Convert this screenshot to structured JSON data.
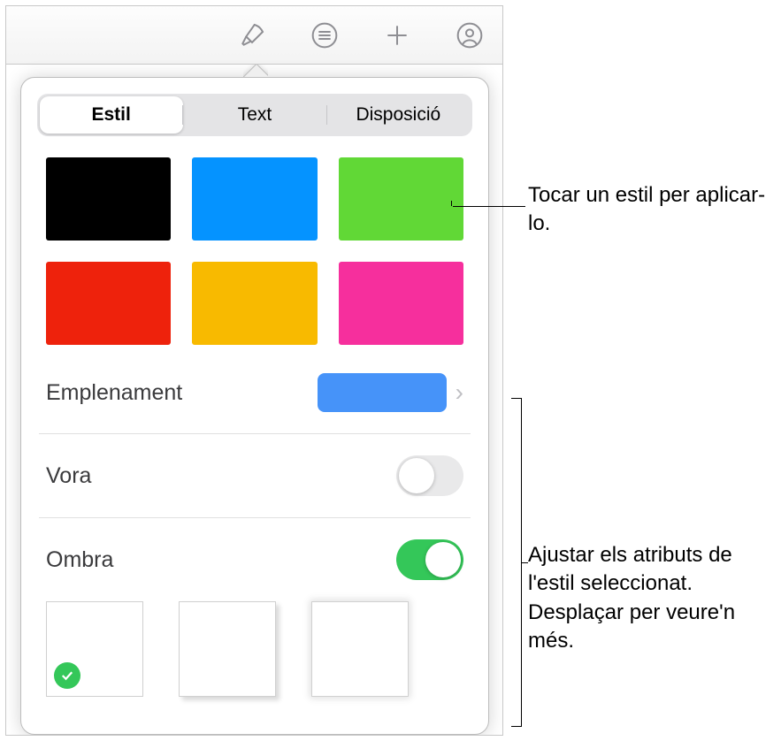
{
  "tabs": {
    "style": "Estil",
    "text": "Text",
    "layout": "Disposició"
  },
  "swatches": {
    "black": "#000000",
    "blue": "#0593ff",
    "green": "#61d836",
    "red": "#ee220c",
    "orange": "#f8ba00",
    "pink": "#f62f9d"
  },
  "rows": {
    "fill": "Emplenament",
    "border": "Vora",
    "shadow": "Ombra"
  },
  "fill_color": "#4693f9",
  "switch": {
    "border": false,
    "shadow": true
  },
  "callouts": {
    "top": "Tocar un estil per aplicar-lo.",
    "bottom": "Ajustar els atributs de l'estil seleccionat. Desplaçar per veure'n més."
  }
}
